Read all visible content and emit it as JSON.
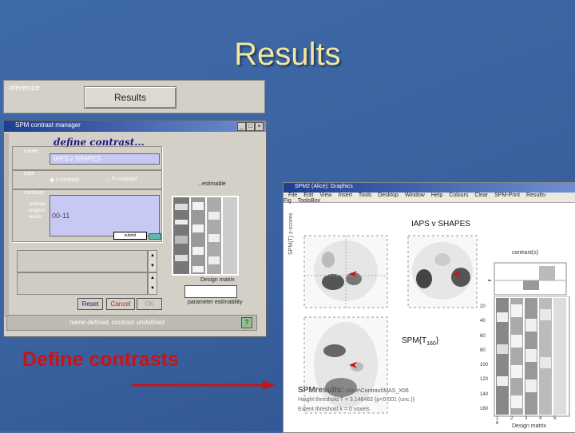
{
  "slide": {
    "title": "Results",
    "caption": "Define contrasts",
    "caption_color": "#c81414",
    "title_color": "#f4e79a"
  },
  "results_strip": {
    "label": "nterence",
    "results_button": "Results"
  },
  "contrast_manager": {
    "window_title": "SPM contrast manager",
    "header": "define contrast...",
    "name_label": "name",
    "name_value": "IAPS v SHAPES",
    "type_label": "type",
    "type_options": [
      "t-contrast",
      "F-contrast"
    ],
    "contrast_label": "contrast",
    "contrast_sublabel": "contrast weights vector",
    "contrast_value": "00-11",
    "submit_button": "submit",
    "estimability_label": "...estimable",
    "design_matrix_label": "Design matrix",
    "param_label": "parameter estimability",
    "buttons": [
      "Reset",
      "Cancel",
      "OK"
    ],
    "status_text": "name defined, contrast undefined",
    "status_button": "?"
  },
  "graphics": {
    "window_title": "SPM2 (Alice): Graphics",
    "menu": [
      "File",
      "Edit",
      "View",
      "Insert",
      "Tools",
      "Desktop",
      "Window",
      "Help",
      "Colours",
      "Clear",
      "SPM-Print",
      "Results-Fig",
      "ToolsBox"
    ],
    "contrast_name": "IAPS v SHAPES",
    "stat_label": "SPM{T",
    "stat_sub": "160",
    "stat_end": "}",
    "results_title": "SPMresults:",
    "results_line1": ".\\Alice\\Contrast\\MAS_X06",
    "results_line2": "Height threshold T = 3.148462 {p<0.001 (unc.)}",
    "results_line3": "Extent threshold k = 0 voxels",
    "contrast_panel": "contrast(s)",
    "design_matrix": "Design matrix",
    "y_ticks": [
      "20",
      "40",
      "60",
      "80",
      "100",
      "120",
      "140",
      "160"
    ],
    "x_ticks": [
      "1",
      "2",
      "3",
      "4",
      "5",
      "6"
    ],
    "mip_label": "SPMmip",
    "mip_coords": "[0, -52, -10]"
  }
}
